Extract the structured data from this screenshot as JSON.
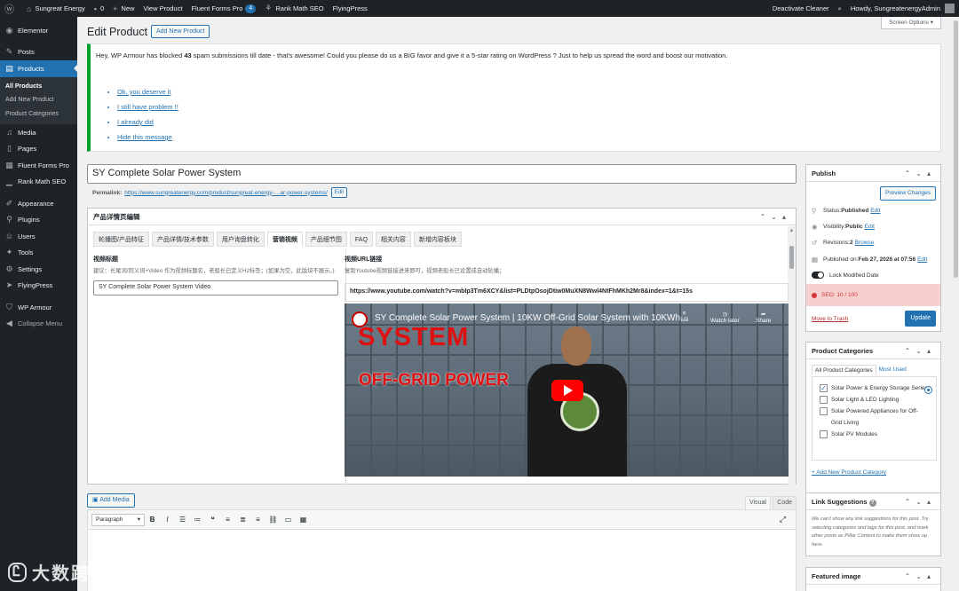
{
  "adminbar": {
    "site_name": "Sungreat Energy",
    "comments": "0",
    "new": "New",
    "view_product": "View Product",
    "fluent_forms": "Fluent Forms Pro",
    "fluent_badge": "4",
    "rank_math": "Rank Math SEO",
    "flyingpress": "FlyingPress",
    "deactivate": "Deactivate Cleaner",
    "howdy": "Howdy, SungreatenergyAdmin"
  },
  "sidebar": {
    "items": [
      "Elementor",
      "Posts",
      "Products",
      "Media",
      "Pages",
      "Fluent Forms Pro",
      "Rank Math SEO",
      "Appearance",
      "Plugins",
      "Users",
      "Tools",
      "Settings",
      "FlyingPress",
      "WP Armour",
      "Collapse Menu"
    ],
    "sub": [
      "All Products",
      "Add New Product",
      "Product Categories"
    ]
  },
  "header": {
    "title": "Edit Product",
    "add_new": "Add New Product",
    "screen_options": "Screen Options ▾"
  },
  "notice": {
    "pre": "Hey, WP Armour has blocked ",
    "count": "43",
    "post": " spam submissions till date - that's awesome! Could you please do us a BIG favor and give it a 5-star rating on WordPress ? Just to help us spread the word and boost our motivation.",
    "links": [
      "Ok, you deserve it",
      "I still have problem !!",
      "I already did",
      "Hide this message"
    ]
  },
  "post": {
    "title": "SY Complete Solar Power System",
    "permalink_label": "Permalink:",
    "permalink_url": "https://www.sungreatenergy.com/product/sungreat-energy-…ar-power-systems/",
    "edit": "Edit"
  },
  "product_box": {
    "title": "产品详情页编辑",
    "tabs": [
      "轮播图/产品特征",
      "产品详情/技术参数",
      "用户询盘转化",
      "营销视频",
      "产品细节图",
      "FAQ",
      "相关内容",
      "新增内容板块"
    ],
    "left_label": "视频标题",
    "left_hint": "建议：长尾词/同义词+Video 作为视频标题名，老船长已定义H2标签；(如果为空，此版块不展示。)",
    "left_value": "SY Complete Solar Power System Video",
    "right_label": "视频URL链接",
    "right_hint": "复制Youtube视频链接进来即可，视频老船长已设置成自动轮播；",
    "url": "https://www.youtube.com/watch?v=mbIp3Tm6XCY&list=PLDtpOsojDtiw0MuXN8Wwl4NtFhMKh2Mr8&index=1&t=15s",
    "video_title": "SY Complete Solar Power System | 10KW Off-Grid Solar System with 10KWh…",
    "video_big1": "SYSTEM",
    "video_big2": "OFF-GRID POWER",
    "vid_counter": "1/2",
    "watch_later": "Watch later",
    "share": "Share"
  },
  "editor": {
    "add_media": "Add Media",
    "visual": "Visual",
    "code": "Code",
    "format": "Paragraph"
  },
  "publish": {
    "title": "Publish",
    "preview": "Preview Changes",
    "status_label": "Status: ",
    "status": "Published",
    "visibility_label": "Visibility: ",
    "visibility": "Public",
    "revisions_label": "Revisions: ",
    "revisions": "2",
    "browse": "Browse",
    "published_on": "Published on: ",
    "date": "Feb 27, 2026 at 07:56",
    "edit": "Edit",
    "lock": "Lock Modified Date",
    "seo": "SEO: 10 / 100",
    "trash": "Move to Trash",
    "update": "Update"
  },
  "categories": {
    "title": "Product Categories",
    "tab_all": "All Product Categories",
    "tab_used": "Most Used",
    "items": [
      "Solar Power & Energy Storage Series",
      "Solar Light & LED Lighting",
      "Solar Powered Appliances for Off-Grid Living",
      "Solar PV Modules"
    ],
    "add": "+ Add New Product Category"
  },
  "link_suggestions": {
    "title": "Link Suggestions",
    "text": "We can't show any link suggestions for this post. Try selecting categories and tags for this post, and mark other posts as Pillar Content to make them show up here."
  },
  "featured": {
    "title": "Featured image"
  },
  "watermark": {
    "text": "大数跨境",
    "logo": "Ꮭ"
  }
}
